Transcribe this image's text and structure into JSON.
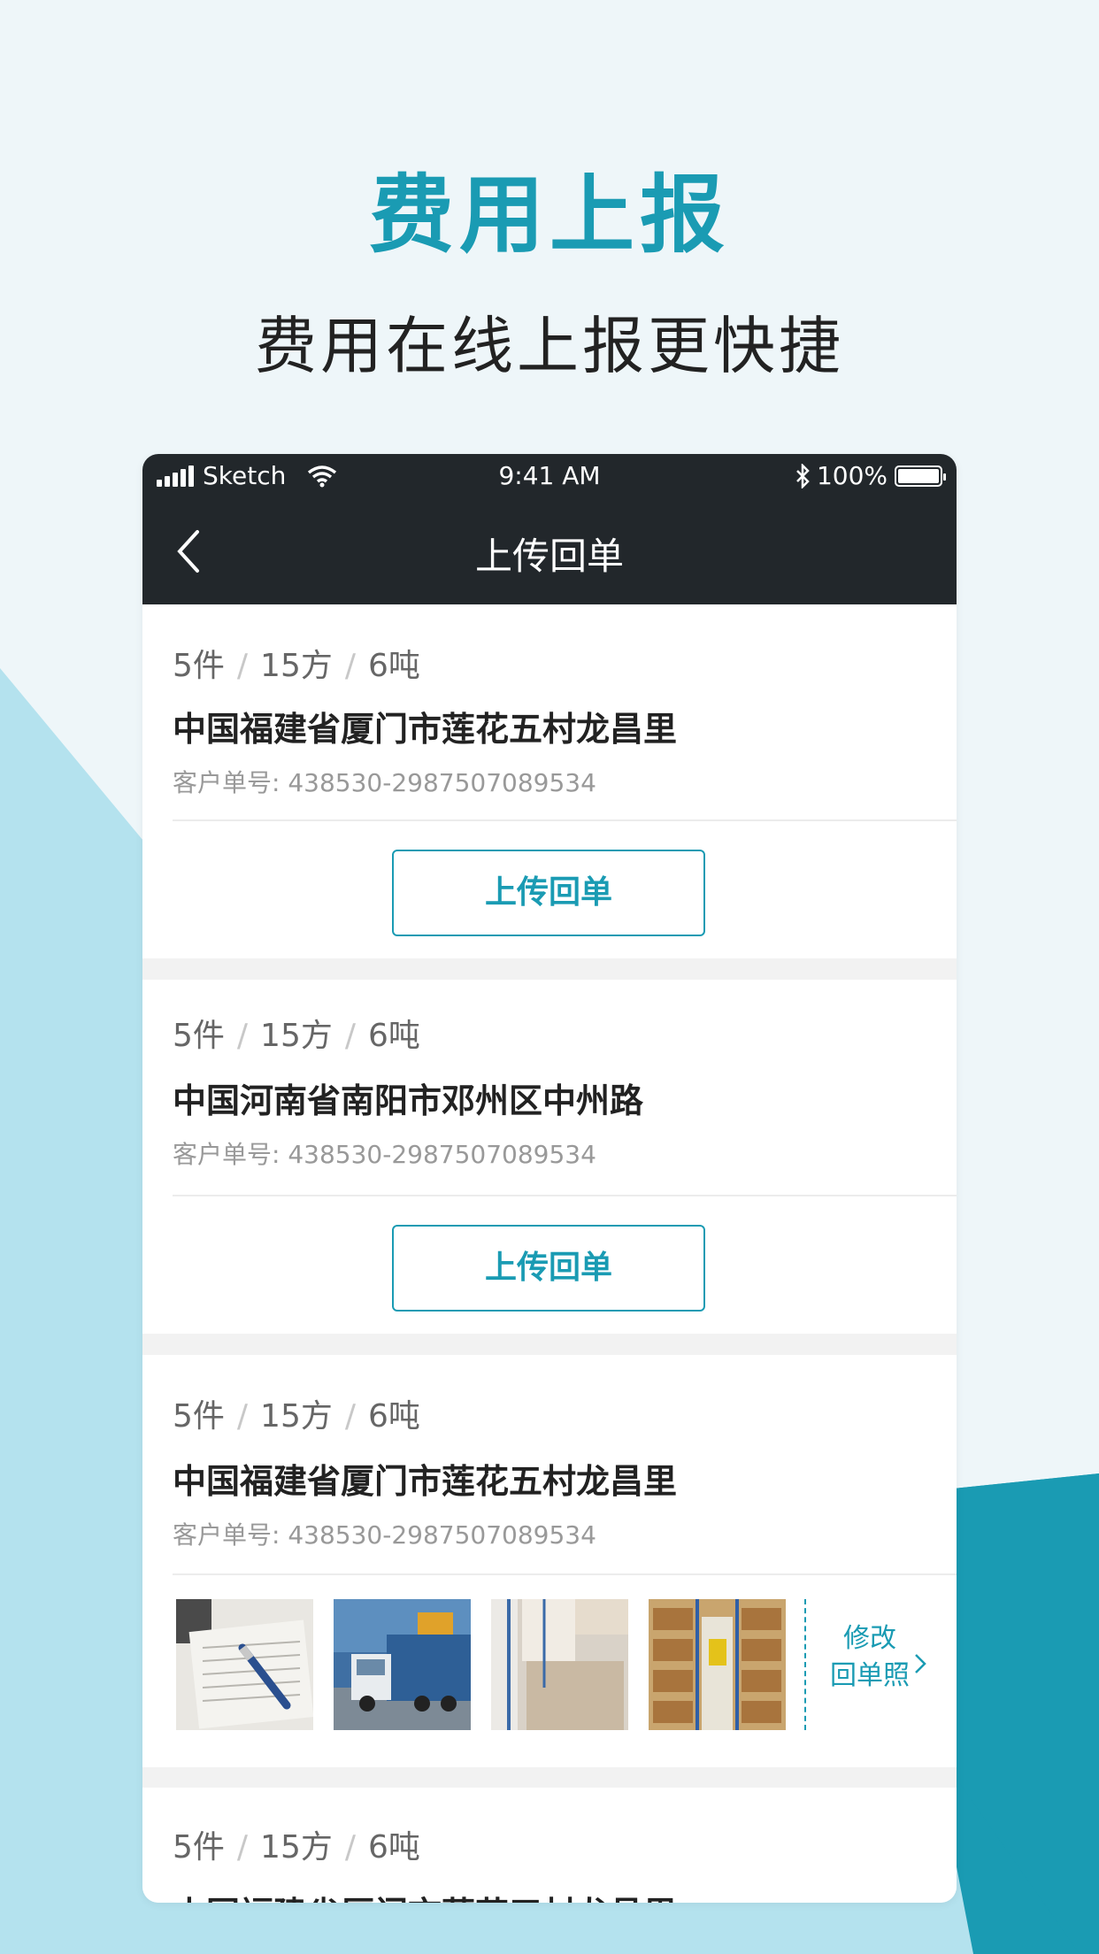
{
  "colors": {
    "accent": "#1a9bb3",
    "statusbar": "#22272b",
    "background": "#eef6f9",
    "shape_light": "#b4e2ee",
    "shape_dark": "#1a9bb3"
  },
  "hero": {
    "title": "费用上报",
    "subtitle": "费用在线上报更快捷"
  },
  "statusbar": {
    "carrier": "Sketch",
    "time": "9:41 AM",
    "battery": "100%",
    "icons": [
      "signal-icon",
      "wifi-icon",
      "bluetooth-icon",
      "battery-icon"
    ]
  },
  "navbar": {
    "title": "上传回单",
    "back_icon": "chevron-left-icon"
  },
  "cards": [
    {
      "pieces": "5件",
      "volume": "15方",
      "weight": "6吨",
      "separator": "/",
      "address": "中国福建省厦门市莲花五村龙昌里",
      "order_label": "客户单号:",
      "order_no": "438530-2987507089534",
      "button": "上传回单"
    },
    {
      "pieces": "5件",
      "volume": "15方",
      "weight": "6吨",
      "separator": "/",
      "address": "中国河南省南阳市邓州区中州路",
      "order_label": "客户单号:",
      "order_no": "438530-2987507089534",
      "button": "上传回单"
    },
    {
      "pieces": "5件",
      "volume": "15方",
      "weight": "6吨",
      "separator": "/",
      "address": "中国福建省厦门市莲花五村龙昌里",
      "order_label": "客户单号:",
      "order_no": "438530-2987507089534",
      "photos": [
        "document-pen-photo",
        "truck-photo",
        "boxes-photo",
        "warehouse-photo"
      ],
      "modify_line1": "修改",
      "modify_line2": "回单照"
    },
    {
      "pieces": "5件",
      "volume": "15方",
      "weight": "6吨",
      "separator": "/",
      "address": "中国福建省厦门市莲花五村龙昌里"
    }
  ]
}
